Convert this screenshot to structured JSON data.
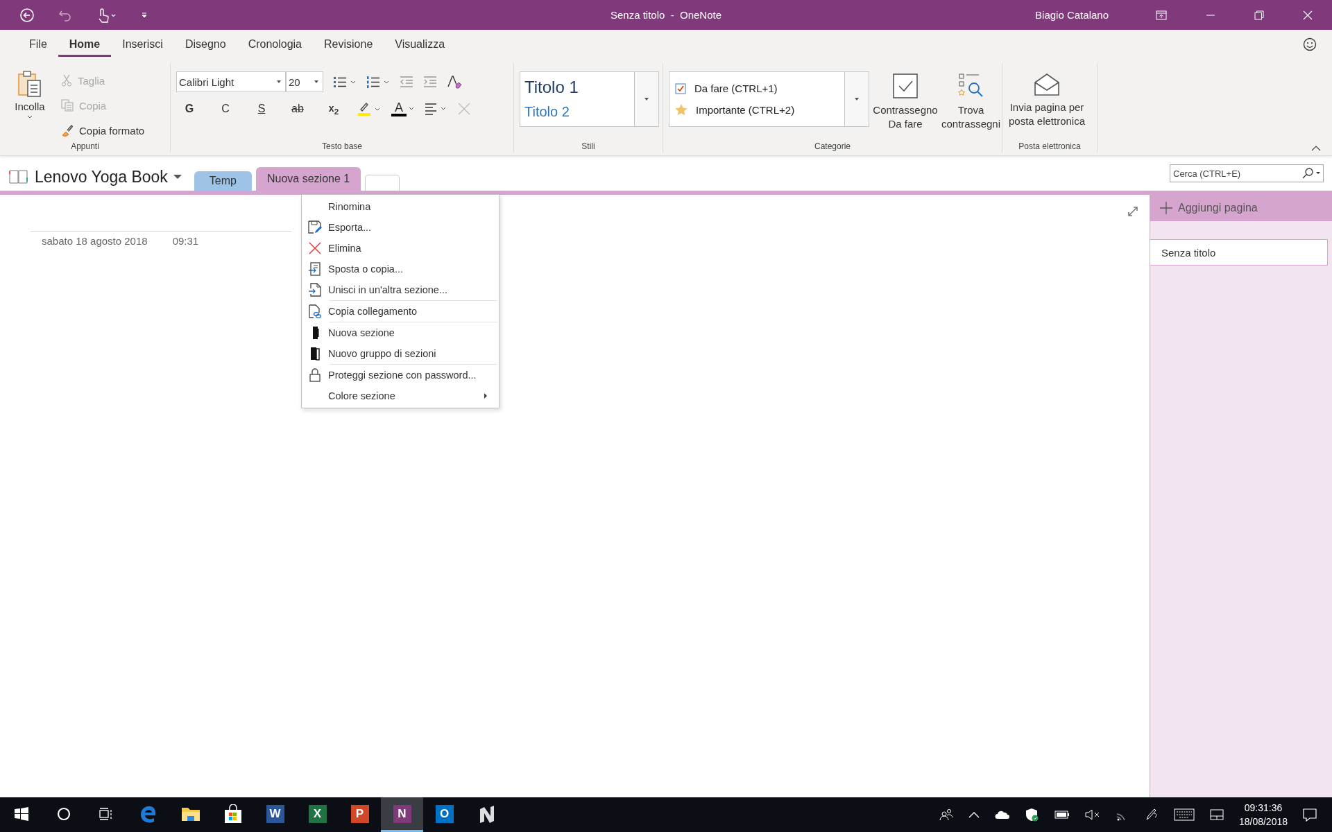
{
  "window": {
    "title": "Senza titolo  -  OneNote",
    "user": "Biagio Catalano"
  },
  "ribbon_tabs": [
    {
      "label": "File",
      "selected": false
    },
    {
      "label": "Home",
      "selected": true
    },
    {
      "label": "Inserisci",
      "selected": false
    },
    {
      "label": "Disegno",
      "selected": false
    },
    {
      "label": "Cronologia",
      "selected": false
    },
    {
      "label": "Revisione",
      "selected": false
    },
    {
      "label": "Visualizza",
      "selected": false
    }
  ],
  "ribbon": {
    "clipboard": {
      "paste": "Incolla",
      "group": "Appunti",
      "items": [
        {
          "label": "Taglia",
          "kind": "cut",
          "disabled": true
        },
        {
          "label": "Copia",
          "kind": "copy",
          "disabled": true
        },
        {
          "label": "Copia formato",
          "kind": "brush",
          "disabled": false
        }
      ]
    },
    "font": {
      "family": "Calibri Light",
      "size": "20",
      "group": "Testo base",
      "format": [
        {
          "label": "G",
          "kind": "bold"
        },
        {
          "label": "C",
          "kind": "italic"
        },
        {
          "label": "S",
          "kind": "underline"
        },
        {
          "label": "ab",
          "kind": "strike"
        },
        {
          "label": "x$_{2}$",
          "kind": "subscript"
        }
      ],
      "color_label": "A"
    },
    "styles": {
      "group": "Stili",
      "items": [
        {
          "label": "Titolo 1",
          "kind": "h1"
        },
        {
          "label": "Titolo 2",
          "kind": "h2"
        }
      ]
    },
    "tags": {
      "group": "Categorie",
      "items": [
        {
          "label": "Da fare (CTRL+1)",
          "kind": "checkbox"
        },
        {
          "label": "Importante (CTRL+2)",
          "kind": "star"
        }
      ],
      "buttons": [
        {
          "label": "Contrassegno Da fare",
          "kind": "todo"
        },
        {
          "label": "Trova contrassegni",
          "kind": "find"
        }
      ]
    },
    "email": {
      "group": "Posta elettronica",
      "button": "Invia pagina per posta elettronica"
    }
  },
  "notebook": {
    "name": "Lenovo Yoga Book",
    "sections": [
      {
        "label": "Temp",
        "color": "#9fc3e7",
        "selected": false
      },
      {
        "label": "Nuova sezione 1",
        "color": "#d5a4cf",
        "selected": true
      }
    ]
  },
  "search": {
    "placeholder": "Cerca (CTRL+E)"
  },
  "page": {
    "date": "sabato 18 agosto 2018",
    "time": "09:31"
  },
  "pages_pane": {
    "add": "Aggiungi pagina",
    "pages": [
      {
        "title": "Senza titolo",
        "selected": true
      }
    ]
  },
  "context_menu": {
    "groups": [
      [
        {
          "label": "Rinomina",
          "kind": "plain",
          "submenu": false
        },
        {
          "label": "Esporta...",
          "kind": "export",
          "submenu": false
        },
        {
          "label": "Elimina",
          "kind": "delete",
          "submenu": false
        },
        {
          "label": "Sposta o copia...",
          "kind": "move",
          "submenu": false
        },
        {
          "label": "Unisci in un'altra sezione...",
          "kind": "merge",
          "submenu": false
        }
      ],
      [
        {
          "label": "Copia collegamento",
          "kind": "link",
          "submenu": false
        }
      ],
      [
        {
          "label": "Nuova sezione",
          "kind": "section",
          "submenu": false
        },
        {
          "label": "Nuovo gruppo di sezioni",
          "kind": "group",
          "submenu": false
        }
      ],
      [
        {
          "label": "Proteggi sezione con password...",
          "kind": "lock",
          "submenu": false
        },
        {
          "label": "Colore sezione",
          "kind": "plain",
          "submenu": true
        }
      ]
    ]
  },
  "taskbar": {
    "apps": [
      {
        "kind": "start",
        "selected": false
      },
      {
        "kind": "cortana",
        "selected": false
      },
      {
        "kind": "taskview",
        "selected": false
      },
      {
        "kind": "edge",
        "selected": false
      },
      {
        "kind": "explorer",
        "selected": false
      },
      {
        "kind": "store",
        "selected": false
      },
      {
        "kind": "office",
        "letter": "W",
        "color": "#2b579a",
        "selected": false
      },
      {
        "kind": "office",
        "letter": "X",
        "color": "#217346",
        "selected": false
      },
      {
        "kind": "office",
        "letter": "P",
        "color": "#d24726",
        "selected": false
      },
      {
        "kind": "office",
        "letter": "N",
        "color": "#80397b",
        "selected": true
      },
      {
        "kind": "office",
        "letter": "O",
        "color": "#0072c6",
        "selected": false
      },
      {
        "kind": "napp",
        "selected": false
      }
    ],
    "time": "09:31:36",
    "date": "18/08/2018"
  }
}
